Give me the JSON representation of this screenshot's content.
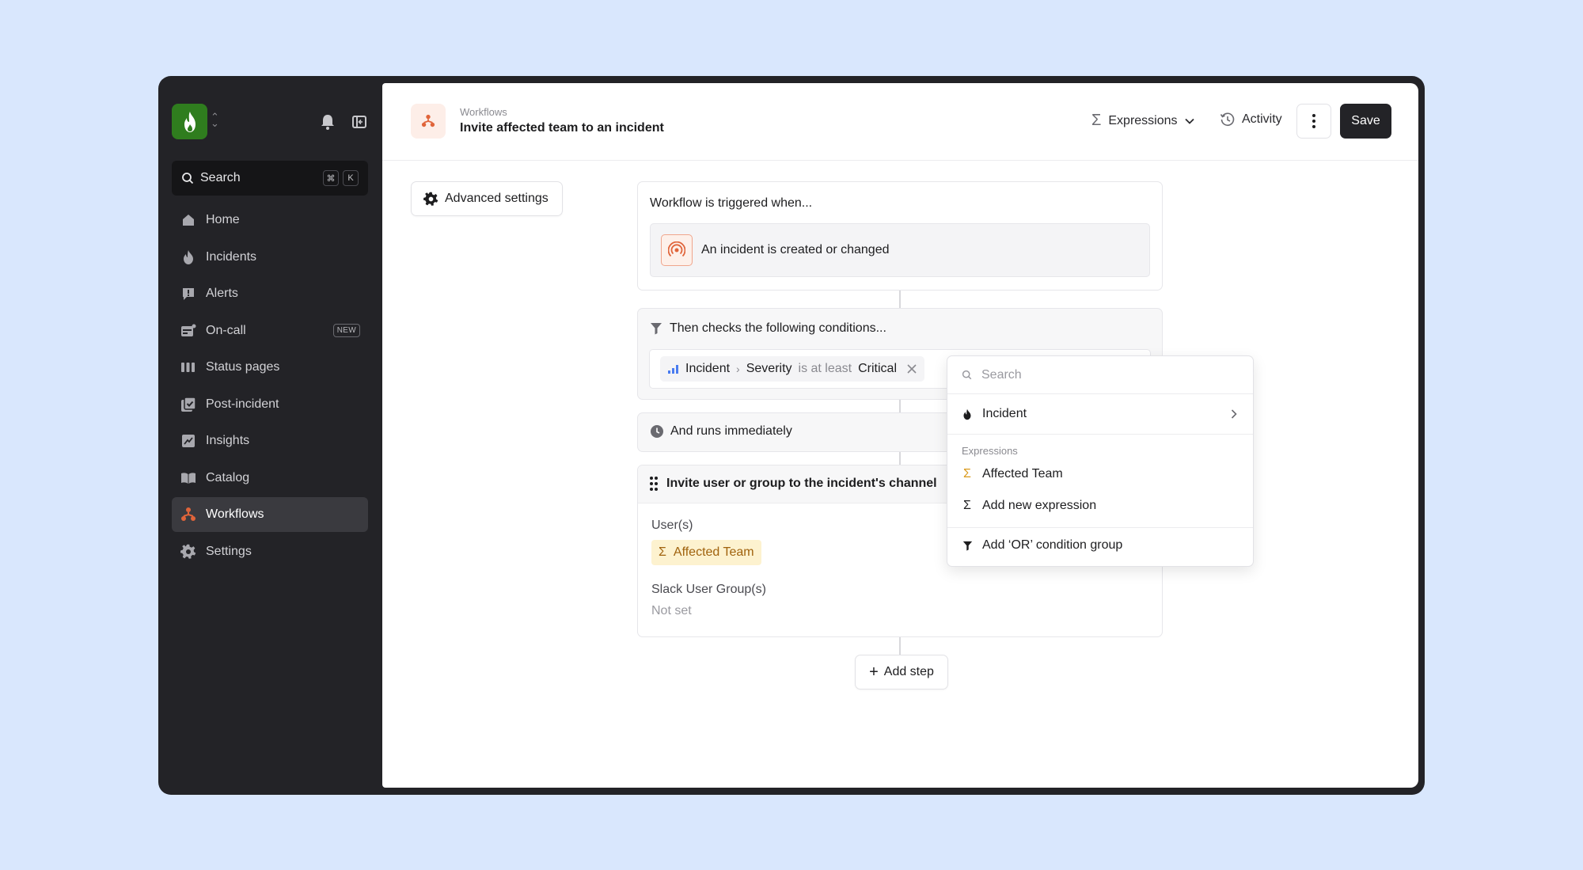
{
  "sidebar": {
    "search_label": "Search",
    "shortcut_keys": [
      "⌘",
      "K"
    ],
    "items": [
      {
        "label": "Home",
        "icon": "home-icon"
      },
      {
        "label": "Incidents",
        "icon": "flame-icon"
      },
      {
        "label": "Alerts",
        "icon": "alert-icon"
      },
      {
        "label": "On-call",
        "icon": "on-call-icon",
        "badge": "NEW"
      },
      {
        "label": "Status pages",
        "icon": "status-pages-icon"
      },
      {
        "label": "Post-incident",
        "icon": "post-incident-icon"
      },
      {
        "label": "Insights",
        "icon": "insights-icon"
      },
      {
        "label": "Catalog",
        "icon": "catalog-icon"
      },
      {
        "label": "Workflows",
        "icon": "workflows-icon",
        "active": true
      },
      {
        "label": "Settings",
        "icon": "settings-icon"
      }
    ]
  },
  "header": {
    "breadcrumb": "Workflows",
    "title": "Invite affected team to an incident",
    "expressions_label": "Expressions",
    "activity_label": "Activity",
    "save_label": "Save"
  },
  "advanced_settings_label": "Advanced settings",
  "trigger": {
    "heading": "Workflow is triggered when...",
    "value": "An incident is created or changed"
  },
  "conditions": {
    "heading": "Then checks the following conditions...",
    "subject": "Incident",
    "field": "Severity",
    "operator": "is at least",
    "value": "Critical"
  },
  "runs": {
    "heading": "And runs immediately"
  },
  "step": {
    "heading": "Invite user or group to the incident's channel",
    "users_label": "User(s)",
    "users_value": "Affected Team",
    "slack_groups_label": "Slack User Group(s)",
    "slack_groups_value": "Not set"
  },
  "add_step_label": "Add step",
  "dropdown": {
    "search_placeholder": "Search",
    "incident_label": "Incident",
    "section_label": "Expressions",
    "affected_team_label": "Affected Team",
    "add_expression_label": "Add new expression",
    "or_group_label": "Add ‘OR’ condition group"
  },
  "colors": {
    "background": "#d9e7fd",
    "sidebar": "#232327",
    "brand_green": "#2f7d1e",
    "accent_orange": "#e0643a",
    "expression_amber": "#d99a1c"
  }
}
